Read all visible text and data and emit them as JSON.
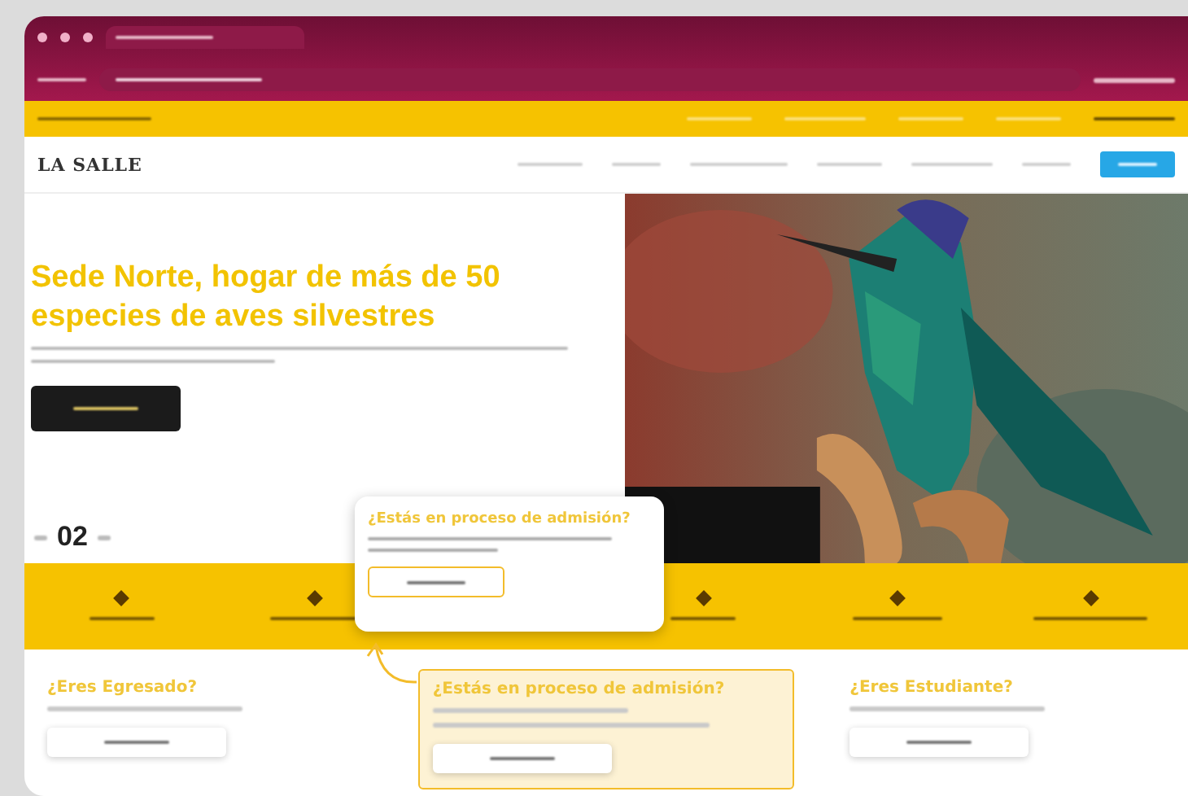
{
  "header": {
    "logo": "LA SALLE"
  },
  "hero": {
    "title": "Sede Norte, hogar de más de 50 especies de aves silvestres",
    "slide": "02"
  },
  "popup": {
    "title": "¿Estás en proceso de admisión?"
  },
  "cards": [
    {
      "title": "¿Eres Egresado?",
      "highlighted": false
    },
    {
      "title": "¿Estás en proceso de admisión?",
      "highlighted": true
    },
    {
      "title": "¿Eres Estudiante?",
      "highlighted": false
    }
  ]
}
